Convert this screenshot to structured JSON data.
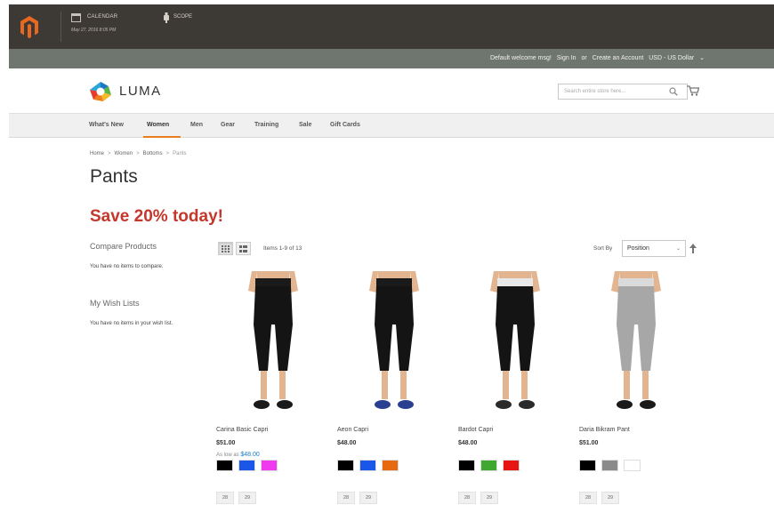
{
  "admin_bar": {
    "calendar_label": "CALENDAR",
    "date": "May 27, 2016 8:05 PM",
    "scope_label": "SCOPE"
  },
  "panel": {
    "welcome": "Default welcome msg!",
    "sign_in": "Sign In",
    "or": "or",
    "create_account": "Create an Account",
    "currency": "USD - US Dollar"
  },
  "header": {
    "logo_text": "LUMA",
    "search_placeholder": "Search entire store here..."
  },
  "nav": {
    "items": [
      "What's New",
      "Women",
      "Men",
      "Gear",
      "Training",
      "Sale",
      "Gift Cards"
    ],
    "active": "Women"
  },
  "breadcrumb": [
    "Home",
    "Women",
    "Bottoms",
    "Pants"
  ],
  "page_title": "Pants",
  "promo": "Save 20% today!",
  "sidebar": {
    "compare_title": "Compare Products",
    "compare_text": "You have no items to compare.",
    "wishlist_title": "My Wish Lists",
    "wishlist_text": "You have no items in your wish list."
  },
  "toolbar": {
    "amount": "Items 1-9 of 13",
    "sort_label": "Sort By",
    "sort_value": "Position"
  },
  "products": [
    {
      "name": "Carina Basic Capri",
      "price": "$51.00",
      "as_low_as_label": "As low as",
      "as_low_as_price": "$48.00",
      "swatches": [
        "#000000",
        "#1a56e8",
        "#ef3af0"
      ],
      "sizes": [
        "28",
        "29"
      ],
      "outfit": {
        "waist": "#1a1a1a",
        "legs": "#141414",
        "shoes": "#1a1a1a"
      }
    },
    {
      "name": "Aeon Capri",
      "price": "$48.00",
      "swatches": [
        "#000000",
        "#1a56e8",
        "#e86a10"
      ],
      "sizes": [
        "28",
        "29"
      ],
      "outfit": {
        "waist": "#1a1a1a",
        "legs": "#141414",
        "shoes": "#2a3f8f"
      }
    },
    {
      "name": "Bardot Capri",
      "price": "$48.00",
      "swatches": [
        "#000000",
        "#3fa82e",
        "#e81414"
      ],
      "sizes": [
        "28",
        "29"
      ],
      "outfit": {
        "waist": "#e8e8e8",
        "legs": "#141414",
        "shoes": "#2a2a2a"
      }
    },
    {
      "name": "Daria Bikram Pant",
      "price": "$51.00",
      "swatches": [
        "#000000",
        "#8a8a8a",
        "#ffffff"
      ],
      "sizes": [
        "28",
        "29"
      ],
      "outfit": {
        "waist": "#dadada",
        "legs": "#a7a7a7",
        "shoes": "#1a1a1a"
      }
    }
  ]
}
